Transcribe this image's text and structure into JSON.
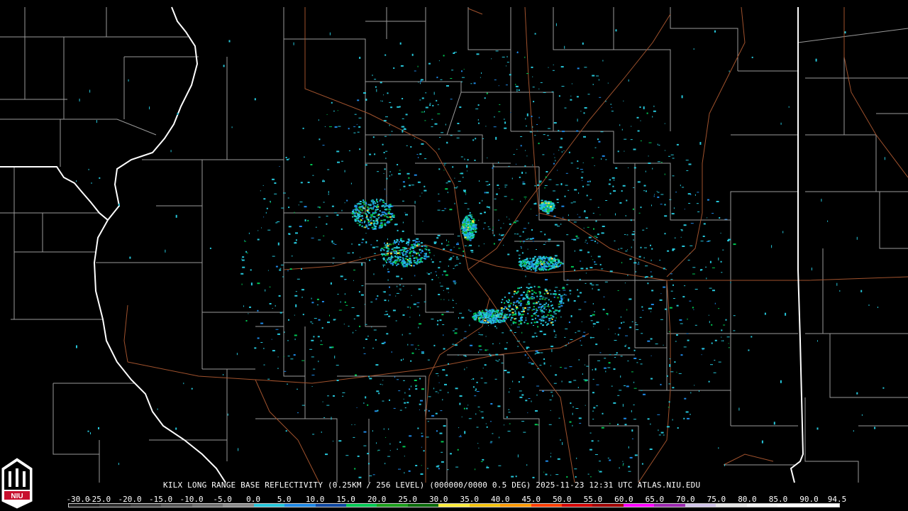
{
  "caption": "KILX LONG RANGE BASE REFLECTIVITY (0.25KM / 256 LEVEL) (000000/0000 0.5 DEG) 2025-11-23 12:31 UTC  ATLAS.NIU.EDU",
  "logo": {
    "text": "NIU",
    "icon": "niu-logo-icon"
  },
  "colorbar": {
    "ticks": [
      "-30.0",
      "-25.0",
      "-20.0",
      "-15.0",
      "-10.0",
      "-5.0",
      "0.0",
      "5.0",
      "10.0",
      "15.0",
      "20.0",
      "25.0",
      "30.0",
      "35.0",
      "40.0",
      "45.0",
      "50.0",
      "55.0",
      "60.0",
      "65.0",
      "70.0",
      "75.0",
      "80.0",
      "85.0",
      "90.0",
      "94.5"
    ],
    "colors": [
      "#1a1a1a",
      "#2d2d2d",
      "#404040",
      "#555555",
      "#6e6e6e",
      "#8a8a8a",
      "#26c6da",
      "#1e88e5",
      "#0d47a1",
      "#00c853",
      "#1b9e1b",
      "#0a6b0a",
      "#ffeb3b",
      "#f4c20d",
      "#ff9800",
      "#ff3d00",
      "#d50000",
      "#a00000",
      "#ff00ff",
      "#9c27b0",
      "#d1c4e9",
      "#e6e6e6",
      "#f5f5f5",
      "#ffffff",
      "#ffffff"
    ]
  },
  "map": {
    "background": "#000000",
    "state_border_color": "#ffffff",
    "county_border_color": "#9a9a9a",
    "highway_color": "#a0522d",
    "echo_colors": [
      "#26c6da",
      "#1e88e5",
      "#0d47a1",
      "#00c853",
      "#1b9e1b",
      "#ffeb3b"
    ]
  }
}
